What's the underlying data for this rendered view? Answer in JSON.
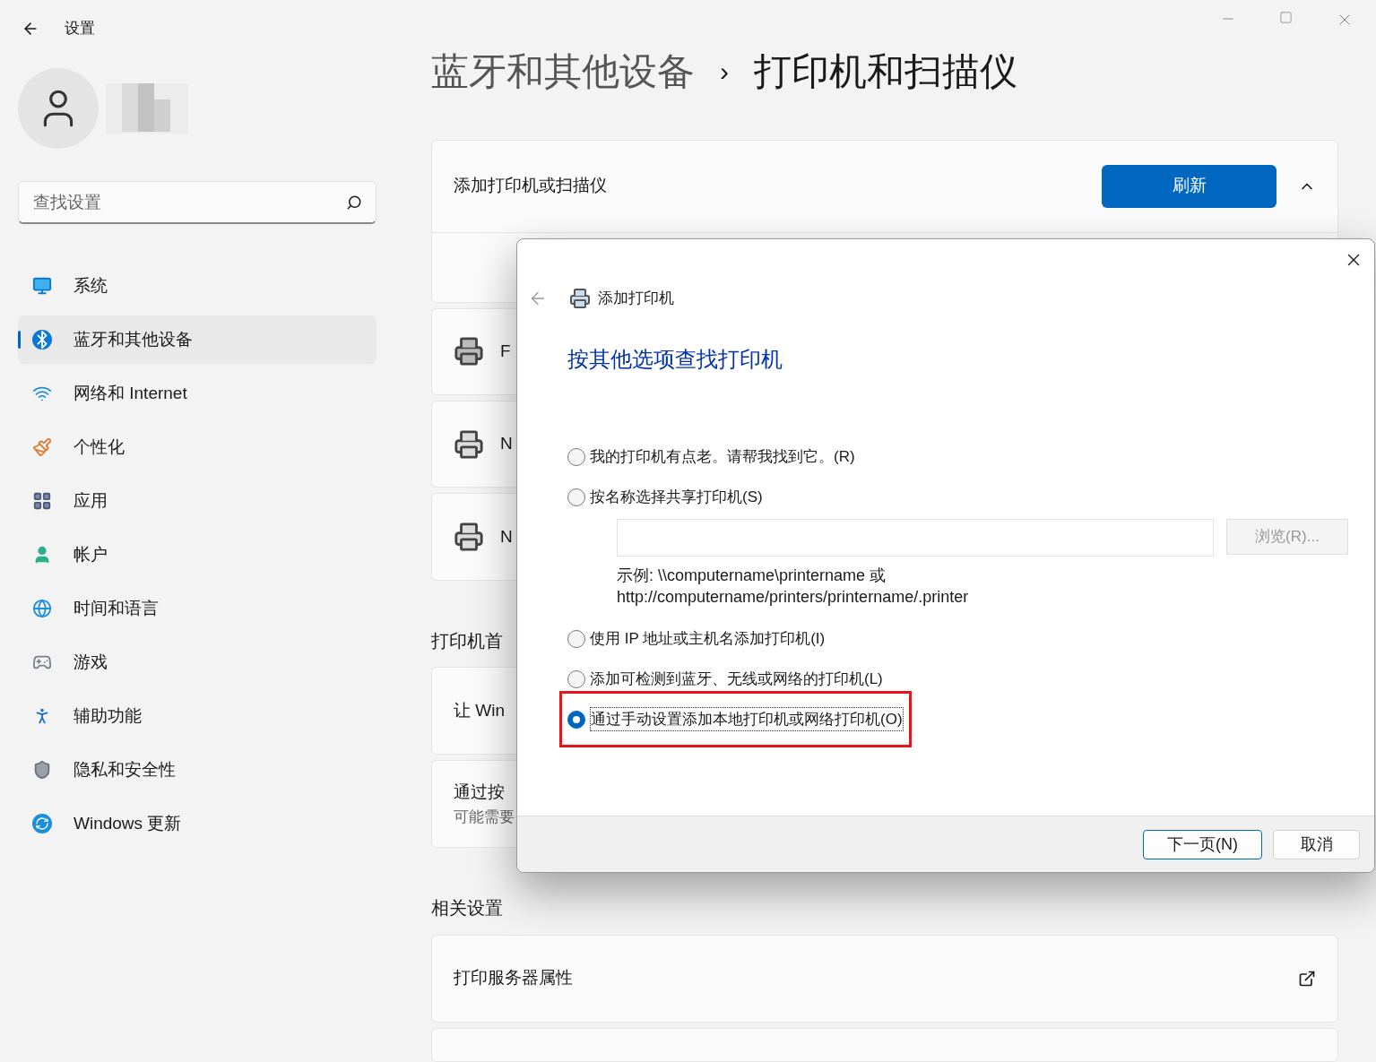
{
  "window": {
    "title": "设置"
  },
  "search": {
    "placeholder": "查找设置"
  },
  "nav": [
    {
      "label": "系统",
      "selected": false
    },
    {
      "label": "蓝牙和其他设备",
      "selected": true
    },
    {
      "label": "网络和 Internet",
      "selected": false
    },
    {
      "label": "个性化",
      "selected": false
    },
    {
      "label": "应用",
      "selected": false
    },
    {
      "label": "帐户",
      "selected": false
    },
    {
      "label": "时间和语言",
      "selected": false
    },
    {
      "label": "游戏",
      "selected": false
    },
    {
      "label": "辅助功能",
      "selected": false
    },
    {
      "label": "隐私和安全性",
      "selected": false
    },
    {
      "label": "Windows 更新",
      "selected": false
    }
  ],
  "breadcrumb": {
    "parent": "蓝牙和其他设备",
    "separator": "›",
    "current": "打印机和扫描仪"
  },
  "add_card": {
    "label": "添加打印机或扫描仪",
    "button": "刷新",
    "expanded": true
  },
  "device_cards": [
    {
      "text": "F",
      "kind": "printer"
    },
    {
      "text": "N",
      "kind": "printer-doc"
    },
    {
      "text": "N",
      "kind": "printer-doc"
    }
  ],
  "preferences": {
    "heading": "打印机首",
    "cards": [
      {
        "title": "让 Win"
      },
      {
        "title": "通过按",
        "subtitle": "可能需要"
      }
    ]
  },
  "related": {
    "heading": "相关设置",
    "items": [
      {
        "label": "打印服务器属性"
      }
    ]
  },
  "dialog": {
    "title": "添加打印机",
    "heading": "按其他选项查找打印机",
    "options": [
      {
        "label": "我的打印机有点老。请帮我找到它。(R)",
        "selected": false
      },
      {
        "label": "按名称选择共享打印机(S)",
        "selected": false
      },
      {
        "label": "使用 IP 地址或主机名添加打印机(I)",
        "selected": false
      },
      {
        "label": "添加可检测到蓝牙、无线或网络的打印机(L)",
        "selected": false
      },
      {
        "label": "通过手动设置添加本地打印机或网络打印机(O)",
        "selected": true
      }
    ],
    "browse": {
      "label": "浏览(R)...",
      "disabled": true
    },
    "example_lines": [
      "示例: \\\\computername\\printername 或",
      "http://computername/printers/printername/.printer"
    ],
    "buttons": [
      "下一页(N)",
      "取消"
    ]
  }
}
